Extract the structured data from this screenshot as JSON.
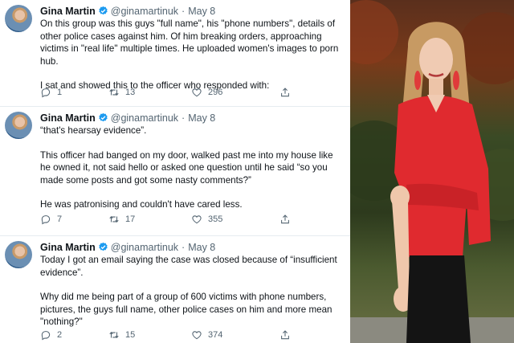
{
  "tweets": [
    {
      "name": "Gina Martin",
      "handle": "@ginamartinuk",
      "dot": "·",
      "date": "May 8",
      "paragraphs": [
        "On this group was this guys \"full name\", his \"phone numbers\", details of other police cases against him. Of him breaking orders, approaching victims in \"real life\" multiple times. He uploaded women's images to porn hub.",
        "I sat and showed this to the officer who responded with:"
      ],
      "replies": "1",
      "retweets": "13",
      "likes": "296"
    },
    {
      "name": "Gina Martin",
      "handle": "@ginamartinuk",
      "dot": "·",
      "date": "May 8",
      "paragraphs": [
        "“that's hearsay evidence”.",
        "This officer had banged on my door, walked past me into my house like he owned it, not said hello or asked one question until he said “so you made some posts and got some nasty comments?”",
        "He was patronising and couldn't have cared less."
      ],
      "replies": "7",
      "retweets": "17",
      "likes": "355"
    },
    {
      "name": "Gina Martin",
      "handle": "@ginamartinuk",
      "dot": "·",
      "date": "May 8",
      "paragraphs": [
        "Today I got an email saying the case was closed because of “insufficient evidence”.",
        "Why did me being part of a group of 600 victims with phone numbers, pictures, the guys full name, other police cases on him and more mean \"nothing?\""
      ],
      "replies": "2",
      "retweets": "15",
      "likes": "374"
    }
  ],
  "icons": {
    "verified": "verified-badge-icon",
    "reply": "reply-icon",
    "retweet": "retweet-icon",
    "like": "heart-icon",
    "share": "share-icon"
  },
  "colors": {
    "verified": "#1d9bf0",
    "meta": "#536471",
    "text": "#0f1419",
    "shirt": "#e02a2f"
  }
}
